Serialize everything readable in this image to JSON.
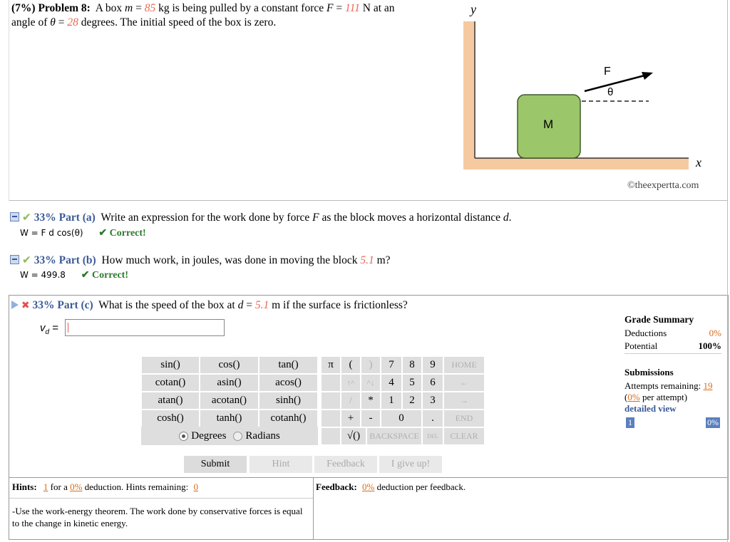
{
  "problem": {
    "percent": "(7%)",
    "title": "Problem 8:",
    "text_a": "A box ",
    "mass_var": "m",
    "mass_eq": " = ",
    "mass": "85",
    "mass_unit": " kg is being pulled by a constant force ",
    "force_var": "F",
    "force_eq": " = ",
    "force": "111",
    "force_unit": " N at an",
    "text_b": "angle of ",
    "angle_var": "θ",
    "angle_eq": " = ",
    "angle": "28",
    "text_c": " degrees. The initial speed of the box is zero."
  },
  "figure": {
    "y_label": "y",
    "x_label": "x",
    "block_label": "M",
    "force_label": "F",
    "angle_label": "θ",
    "copyright": "©theexpertta.com"
  },
  "part_a": {
    "percent": "33% Part (a)",
    "question_a": "Write an expression for the work done by force ",
    "q_var": "F",
    "question_b": " as the block moves a horizontal distance ",
    "q_var2": "d",
    "question_c": ".",
    "answer": "W = F d cos(θ)",
    "status": "✔ Correct!"
  },
  "part_b": {
    "percent": "33% Part (b)",
    "question_a": "How much work, in joules, was done in moving the block ",
    "distance": "5.1",
    "question_b": " m?",
    "answer": "W = 499.8",
    "status": "✔ Correct!"
  },
  "part_c": {
    "percent": "33% Part (c)",
    "question_a": "What is the speed of the box at ",
    "q_var": "d",
    "q_eq": " = ",
    "distance": "5.1",
    "question_b": " m if the surface is frictionless?",
    "input_label": "v",
    "input_sub": "d",
    "input_eq": " = ",
    "input_value": ""
  },
  "keypad": {
    "functions": [
      [
        "sin()",
        "cos()",
        "tan()"
      ],
      [
        "cotan()",
        "asin()",
        "acos()"
      ],
      [
        "atan()",
        "acotan()",
        "sinh()"
      ],
      [
        "cosh()",
        "tanh()",
        "cotanh()"
      ]
    ],
    "degrees": "Degrees",
    "radians": "Radians",
    "pi": "π",
    "lparen": "(",
    "rparen": ")",
    "up": "↑^",
    "down": "^↓",
    "times": "*",
    "divide": "/",
    "plus": "+",
    "minus": "-",
    "sqrt": "√()",
    "backspace": "BACKSPACE",
    "del": "DEL",
    "clear": "CLEAR",
    "home": "HOME",
    "end": "END",
    "left_arrow": "←",
    "right_arrow": "→",
    "digits": [
      "7",
      "8",
      "9",
      "4",
      "5",
      "6",
      "1",
      "2",
      "3",
      "0",
      "."
    ]
  },
  "buttons": {
    "submit": "Submit",
    "hint": "Hint",
    "feedback": "Feedback",
    "giveup": "I give up!"
  },
  "grade": {
    "title": "Grade Summary",
    "deductions_label": "Deductions",
    "deductions_value": "0%",
    "potential_label": "Potential",
    "potential_value": "100%",
    "submissions_title": "Submissions",
    "attempts_label": "Attempts remaining: ",
    "attempts_value": "19",
    "per_attempt_pct": "0%",
    "per_attempt_label": " per attempt)",
    "per_attempt_open": "(",
    "detailed_view": "detailed view",
    "bar_left": "1",
    "bar_right": "0%"
  },
  "hints": {
    "label": "Hints:",
    "count": "1",
    "for_a": " for a ",
    "pct": "0%",
    "deduction": " deduction. Hints remaining:",
    "remaining": "0",
    "text": "-Use the work-energy theorem. The work done by conservative forces is equal to the change in kinetic energy."
  },
  "feedback": {
    "label": "Feedback:",
    "pct": "0%",
    "text": " deduction per feedback."
  },
  "colors": {
    "accent_blue": "#3a5a98",
    "given_red": "#e8684f",
    "correct_green": "#2c7a2c",
    "keypad_gray": "#dedede"
  }
}
